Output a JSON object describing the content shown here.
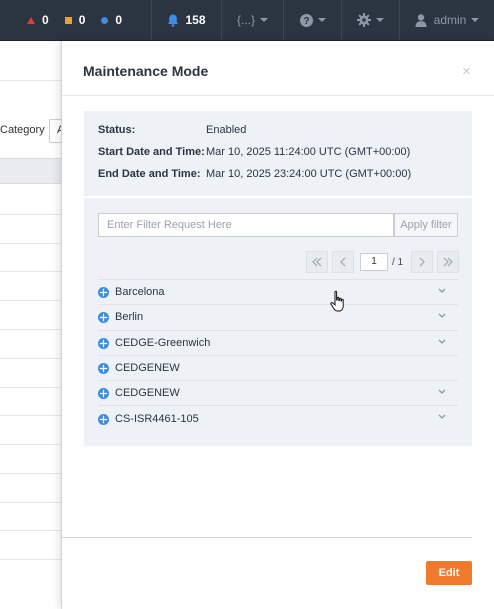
{
  "topbar": {
    "alerts": [
      {
        "icon": "critical-triangle-icon",
        "count": "0",
        "color": "#e2402b"
      },
      {
        "icon": "major-square-icon",
        "count": "0",
        "color": "#f0a32a"
      },
      {
        "icon": "minor-dot-icon",
        "count": "0",
        "color": "#3d8de0"
      }
    ],
    "notifications": "158",
    "brace_label": "{...}",
    "user": "admin"
  },
  "background": {
    "category_label": "Category",
    "category_value": "A"
  },
  "panel": {
    "title": "Maintenance Mode",
    "close_glyph": "×",
    "status": {
      "status_label": "Status:",
      "status_value": "Enabled",
      "start_label": "Start Date and Time:",
      "start_value": "Mar 10, 2025 11:24:00 UTC (GMT+00:00)",
      "end_label": "End Date and Time:",
      "end_value": "Mar 10, 2025 23:24:00 UTC (GMT+00:00)"
    },
    "filter": {
      "placeholder": "Enter Filter Request Here",
      "button": "Apply filter"
    },
    "pager": {
      "page": "1",
      "total": "/ 1"
    },
    "devices": [
      {
        "name": "Barcelona",
        "expandable": true
      },
      {
        "name": "Berlin",
        "expandable": true
      },
      {
        "name": "CEDGE-Greenwich",
        "expandable": true
      },
      {
        "name": "CEDGENEW",
        "expandable": false
      },
      {
        "name": "CEDGENEW",
        "expandable": true
      },
      {
        "name": "CS-ISR4461-105",
        "expandable": true
      }
    ],
    "edit_button": "Edit"
  },
  "colors": {
    "topbar_bg": "#2b3441",
    "accent_orange": "#f07a2c",
    "router_blue": "#3d8de0",
    "panel_section_bg": "#eef2f7"
  }
}
